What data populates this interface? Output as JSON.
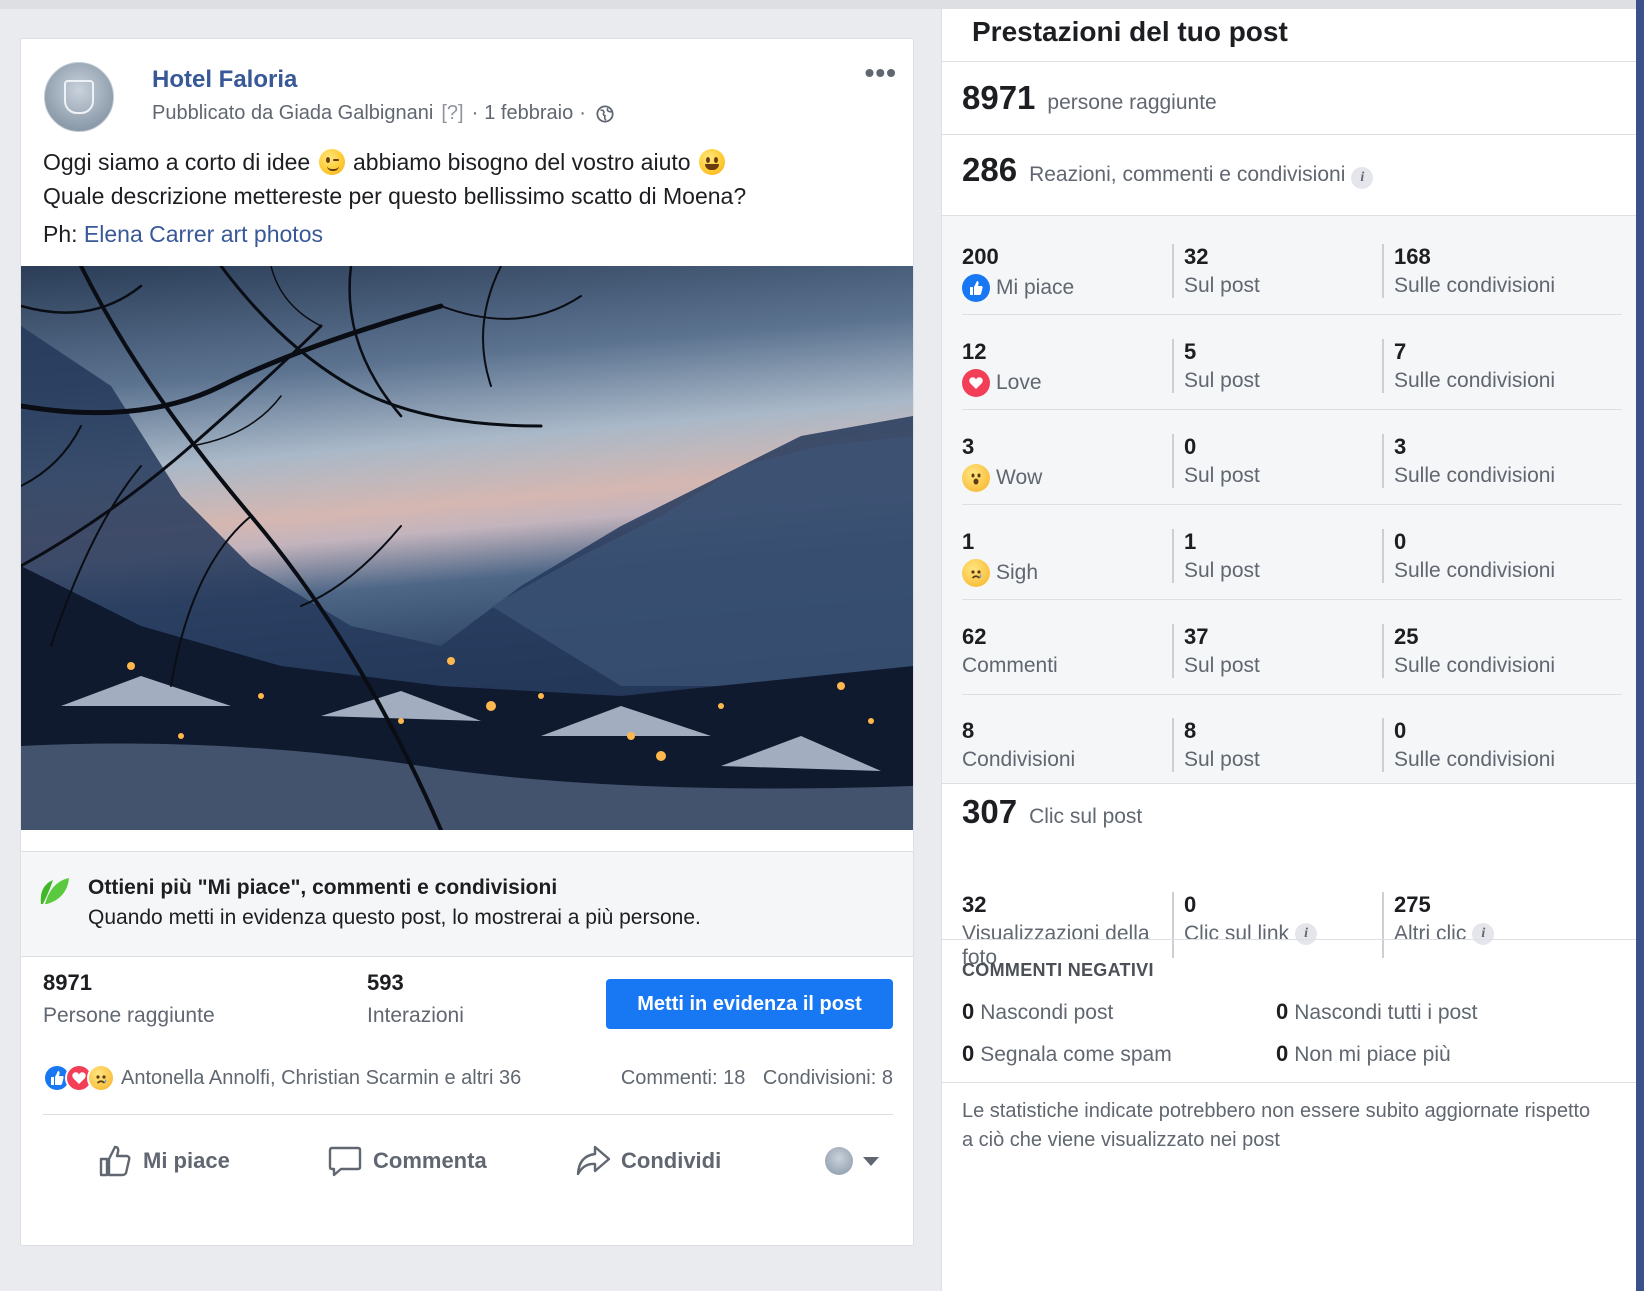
{
  "post": {
    "page_name": "Hotel Faloria",
    "published_by": "Pubblicato da Giada Galbignani",
    "help_marker": "[?]",
    "date": "1 febbraio",
    "text_line1_a": "Oggi siamo a corto di idee",
    "text_line1_b": "abbiamo bisogno del vostro aiuto",
    "text_line2": "Quale descrizione mettereste per questo bellissimo scatto di Moena?",
    "credit_prefix": "Ph:",
    "credit_link": "Elena Carrer art photos",
    "icons": [
      "globe-icon",
      "more-options-icon",
      "wink-emoji",
      "grin-emoji"
    ]
  },
  "boost": {
    "title": "Ottieni più \"Mi piace\", commenti e condivisioni",
    "description": "Quando metti in evidenza questo post, lo mostrerai a più persone.",
    "button_label": "Metti in evidenza il post"
  },
  "post_stats": {
    "reach_value": "8971",
    "reach_label": "Persone raggiunte",
    "interactions_value": "593",
    "interactions_label": "Interazioni"
  },
  "reactions": {
    "names": "Antonella Annolfi, Christian Scarmin e altri 36",
    "comments": "Commenti: 18",
    "shares": "Condivisioni: 8"
  },
  "actions": {
    "like": "Mi piace",
    "comment": "Commenta",
    "share": "Condividi"
  },
  "insights": {
    "title": "Prestazioni del tuo post",
    "reached_value": "8971",
    "reached_label": "persone raggiunte",
    "engagement_value": "286",
    "engagement_label": "Reazioni, commenti e condivisioni",
    "rows": [
      {
        "total": "200",
        "label": "Mi piace",
        "on_post": "32",
        "on_post_label": "Sul post",
        "on_shares": "168",
        "on_shares_label": "Sulle condivisioni"
      },
      {
        "total": "12",
        "label": "Love",
        "on_post": "5",
        "on_post_label": "Sul post",
        "on_shares": "7",
        "on_shares_label": "Sulle condivisioni"
      },
      {
        "total": "3",
        "label": "Wow",
        "on_post": "0",
        "on_post_label": "Sul post",
        "on_shares": "3",
        "on_shares_label": "Sulle condivisioni"
      },
      {
        "total": "1",
        "label": "Sigh",
        "on_post": "1",
        "on_post_label": "Sul post",
        "on_shares": "0",
        "on_shares_label": "Sulle condivisioni"
      },
      {
        "total": "62",
        "label": "Commenti",
        "on_post": "37",
        "on_post_label": "Sul post",
        "on_shares": "25",
        "on_shares_label": "Sulle condivisioni"
      },
      {
        "total": "8",
        "label": "Condivisioni",
        "on_post": "8",
        "on_post_label": "Sul post",
        "on_shares": "0",
        "on_shares_label": "Sulle condivisioni"
      }
    ],
    "clicks_value": "307",
    "clicks_label": "Clic sul post",
    "photo_views_value": "32",
    "photo_views_label_1": "Visualizzazioni della",
    "photo_views_label_2": "foto",
    "link_clicks_value": "0",
    "link_clicks_label": "Clic sul link",
    "other_clicks_value": "275",
    "other_clicks_label": "Altri clic",
    "negative_title": "COMMENTI NEGATIVI",
    "negative": [
      {
        "value": "0",
        "label": "Nascondi post"
      },
      {
        "value": "0",
        "label": "Nascondi tutti i post"
      },
      {
        "value": "0",
        "label": "Segnala come spam"
      },
      {
        "value": "0",
        "label": "Non mi piace più"
      }
    ],
    "footnote": "Le statistiche indicate potrebbero non essere subito aggiornate rispetto a ciò che viene visualizzato nei post"
  },
  "colors": {
    "link": "#385898",
    "boost_button": "#1877f2",
    "like_blue": "#1877f2",
    "love_red": "#f33e58",
    "secondary_text": "#606770"
  }
}
